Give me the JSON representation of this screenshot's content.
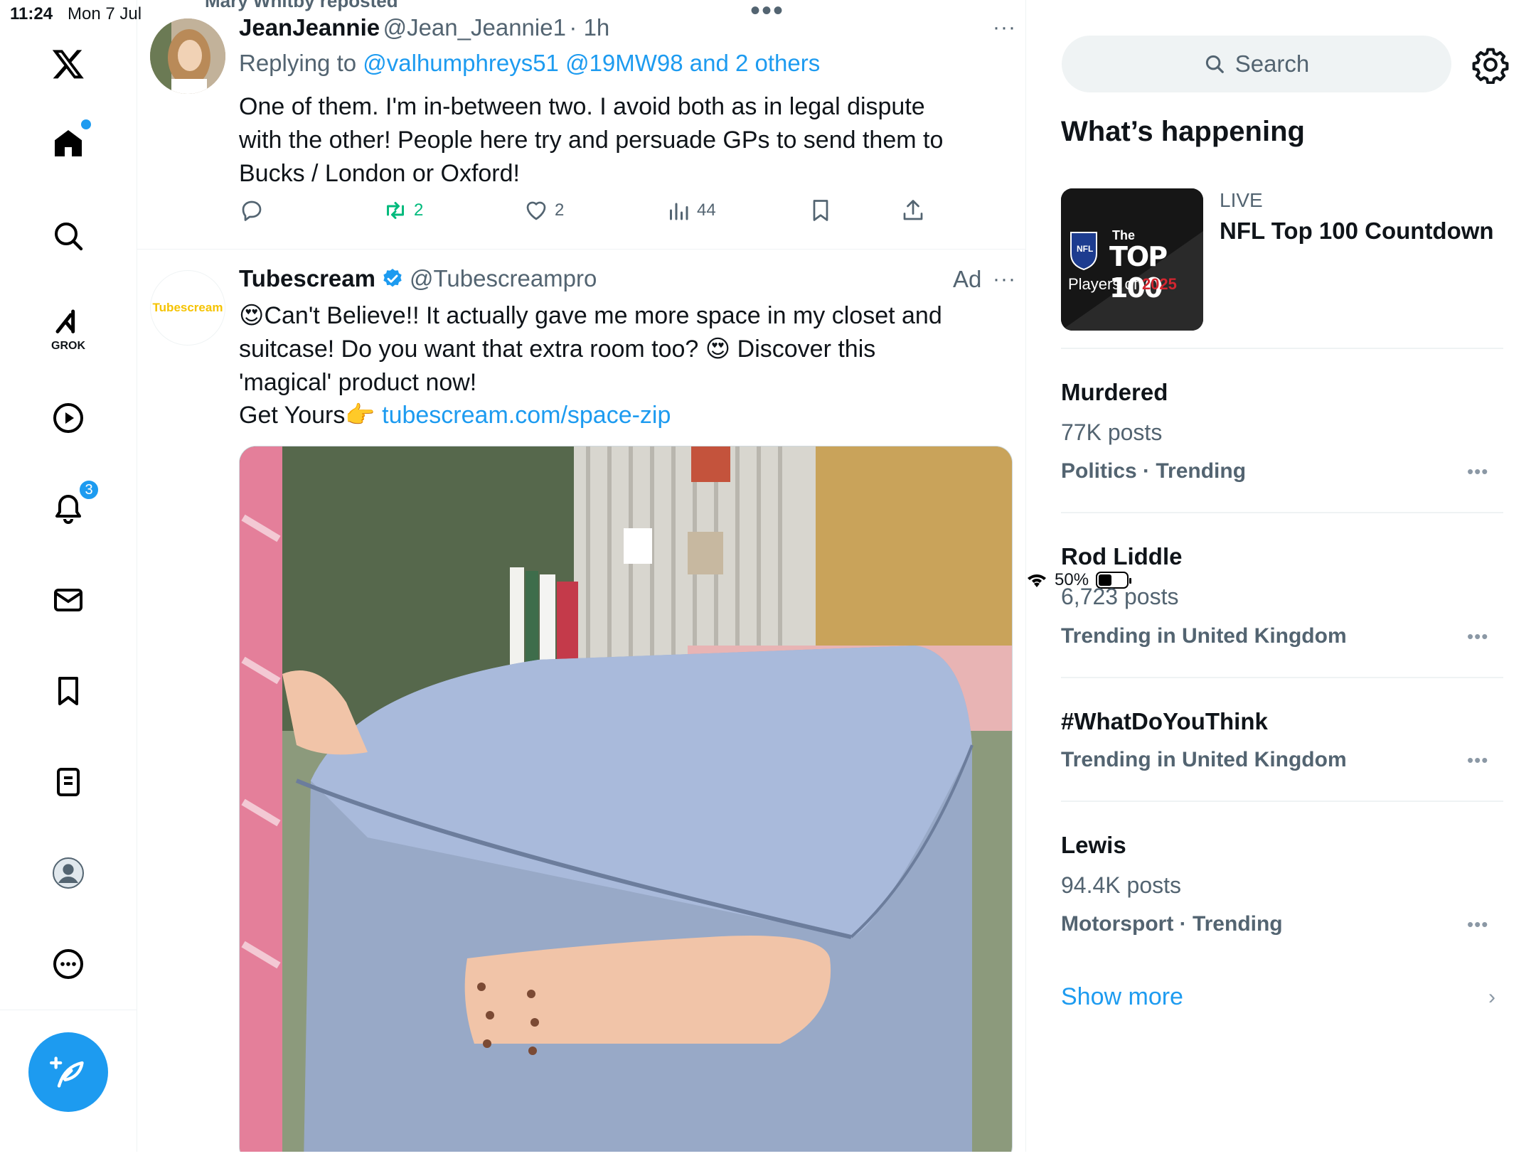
{
  "status_bar": {
    "time": "11:24",
    "date": "Mon 7 Jul",
    "battery": "50%"
  },
  "nav": {
    "notifications_badge": "3",
    "grok_label": "GROK"
  },
  "feed": {
    "repost_line": "Mary Whitby reposted",
    "tweet1": {
      "name": "JeanJeannie",
      "handle": "@Jean_Jeannie1",
      "time": "· 1h",
      "replying_prefix": "Replying to ",
      "replying_to": "@valhumphreys51 @19MW98 and 2 others",
      "text": "One of them. I'm in-between two. I avoid both as in legal dispute with the other! People here try and persuade GPs to send them to Bucks / London or Oxford!",
      "reposts": "2",
      "likes": "2",
      "views": "44"
    },
    "tweet2": {
      "name": "Tubescream",
      "handle": "@Tubescreampro",
      "ad_label": "Ad",
      "avatar_text": "Tubescream",
      "line1": "😍Can't Believe!! It actually gave me more space in my closet and suitcase! Do you want that extra room too? 😍 Discover this 'magical' product now!",
      "cta_prefix": "Get Yours👉 ",
      "link": "tubescream.com/space-zip"
    }
  },
  "sidebar": {
    "search_placeholder": "Search",
    "section_title": "What’s happening",
    "live": {
      "label": "LIVE",
      "title": "NFL Top 100 Countdown",
      "thumb_line1": "The",
      "thumb_line2": "TOP 100",
      "thumb_line3": "Players of ",
      "thumb_year": "2025",
      "thumb_badge": "NFL"
    },
    "trends": [
      {
        "name": "Murdered",
        "count": "77K posts",
        "category": "Politics · Trending"
      },
      {
        "name": "Rod Liddle",
        "count": "6,723 posts",
        "category": "Trending in United Kingdom"
      },
      {
        "name": "#WhatDoYouThink",
        "count": "",
        "category": "Trending in United Kingdom"
      },
      {
        "name": "Lewis",
        "count": "94.4K posts",
        "category": "Motorsport · Trending"
      }
    ],
    "show_more": "Show more"
  },
  "colors": {
    "accent": "#1d9bf0",
    "text": "#0f1419",
    "muted": "#536471",
    "repost_green": "#00ba7c"
  }
}
